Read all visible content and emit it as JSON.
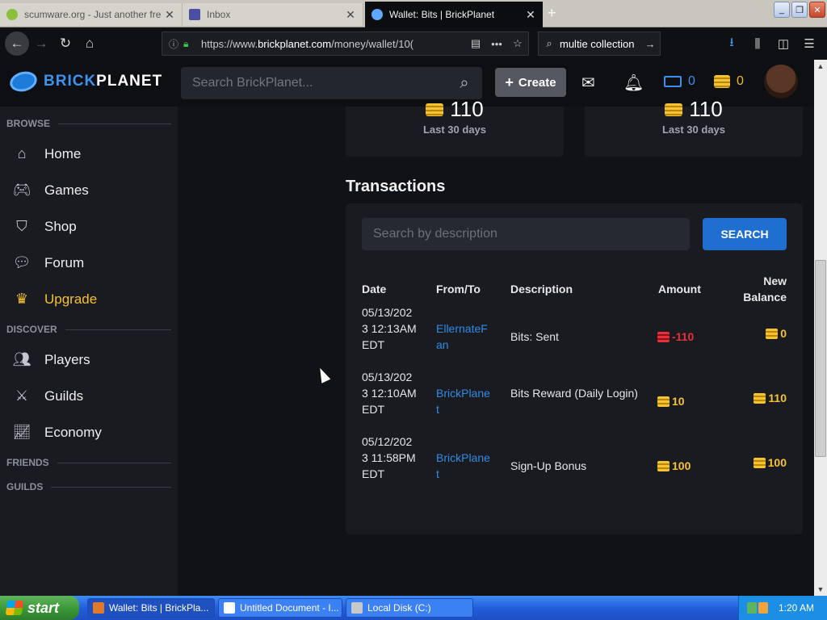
{
  "browser": {
    "tabs": [
      {
        "label": "scumware.org - Just another fre",
        "active": false
      },
      {
        "label": "Inbox",
        "active": false
      },
      {
        "label": "Wallet: Bits | BrickPlanet",
        "active": true
      }
    ],
    "url_prefix": "https://www.",
    "url_domain": "brickplanet.com",
    "url_path": "/money/wallet/10(",
    "search_text": "multie collection"
  },
  "site": {
    "logo_brick": "BRICK",
    "logo_planet": "PLANET",
    "search_placeholder": "Search BrickPlanet...",
    "create_label": "Create",
    "cash_count": "0",
    "bits_count": "0"
  },
  "sidebar": {
    "browse_label": "BROWSE",
    "browse_items": [
      {
        "label": "Home",
        "icon": "home-icon"
      },
      {
        "label": "Games",
        "icon": "gamepad-icon"
      },
      {
        "label": "Shop",
        "icon": "basket-icon"
      },
      {
        "label": "Forum",
        "icon": "forum-icon"
      },
      {
        "label": "Upgrade",
        "icon": "crown-icon"
      }
    ],
    "discover_label": "DISCOVER",
    "discover_items": [
      {
        "label": "Players",
        "icon": "users-icon"
      },
      {
        "label": "Guilds",
        "icon": "swords-icon"
      },
      {
        "label": "Economy",
        "icon": "chart-icon"
      }
    ],
    "friends_label": "FRIENDS",
    "guilds_label": "GUILDS"
  },
  "stats": [
    {
      "value": "110",
      "label": "Last 30 days"
    },
    {
      "value": "110",
      "label": "Last 30 days"
    }
  ],
  "transactions": {
    "title": "Transactions",
    "search_placeholder": "Search by description",
    "search_button": "SEARCH",
    "headers": {
      "date": "Date",
      "from": "From/To",
      "description": "Description",
      "amount": "Amount",
      "balance_line1": "New",
      "balance_line2": "Balance"
    },
    "rows": [
      {
        "date": "05/13/2023 12:13AM EDT",
        "from": "EllernateFan",
        "description": "Bits: Sent",
        "amount": "-110",
        "balance": "0"
      },
      {
        "date": "05/13/2023 12:10AM EDT",
        "from": "BrickPlanet",
        "description": "Bits Reward (Daily Login)",
        "amount": "10",
        "balance": "110"
      },
      {
        "date": "05/12/2023 11:58PM EDT",
        "from": "BrickPlanet",
        "description": "Sign-Up Bonus",
        "amount": "100",
        "balance": "100"
      }
    ]
  },
  "taskbar": {
    "start_label": "start",
    "tasks": [
      {
        "label": "Wallet: Bits | BrickPla..."
      },
      {
        "label": "Untitled Document - I..."
      },
      {
        "label": "Local Disk (C:)"
      }
    ],
    "clock": "1:20 AM"
  },
  "colors": {
    "accent_blue": "#1f6fd0",
    "bits_gold": "#f5c232",
    "negative_red": "#e8303a",
    "upgrade_gold": "#f5c12e"
  }
}
